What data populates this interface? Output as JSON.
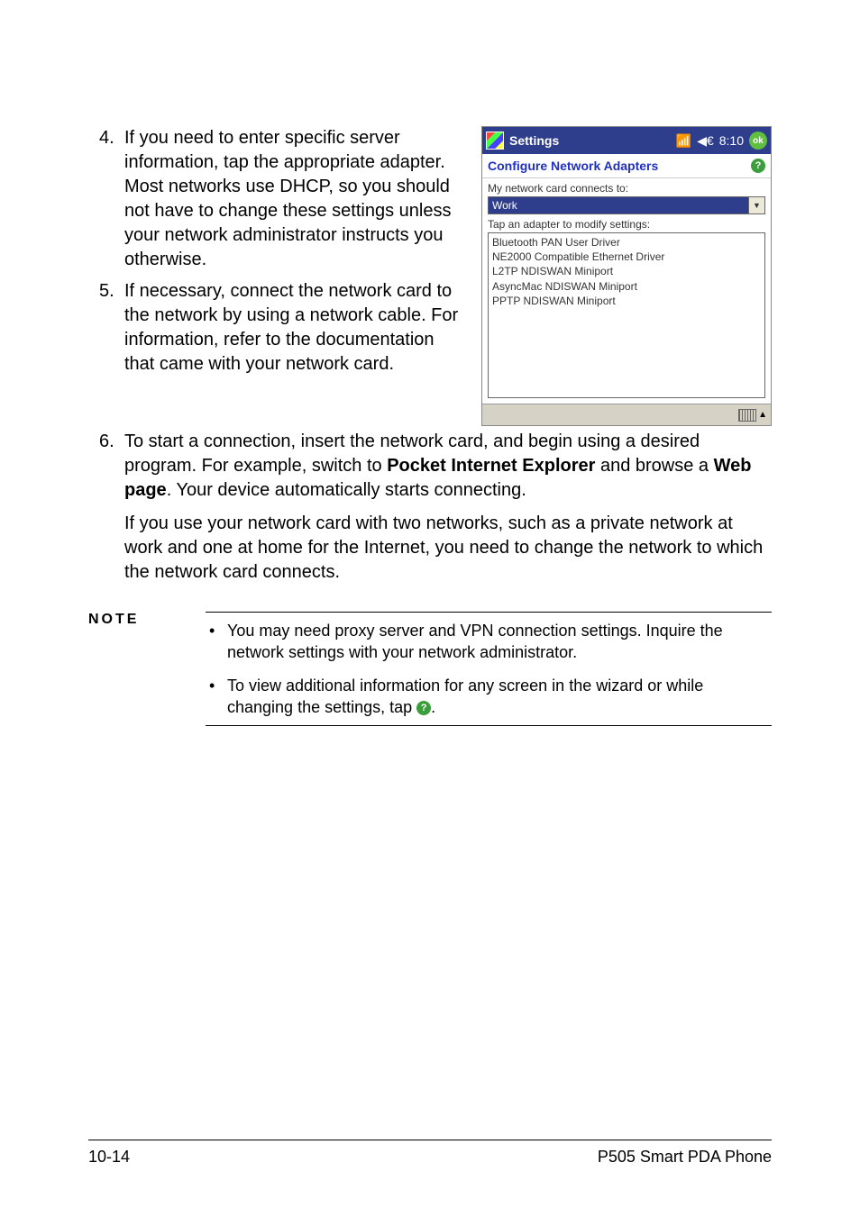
{
  "steps": {
    "s4": "If you need to enter specific server information, tap the appropriate adapter. Most networks use DHCP, so you should not have to change these settings unless your network administrator instructs you otherwise.",
    "s5": "If necessary, connect the network card to the network by using a network cable. For information, refer to the documentation that came with your network card.",
    "s6_pre": "To start a connection, insert the network card, and begin using a desired program. For example, switch to ",
    "s6_b1": "Pocket Internet Explorer",
    "s6_mid": " and browse a ",
    "s6_b2": "Web page",
    "s6_post": ". Your device automatically starts connecting.",
    "para2": "If you use your network card with two networks, such as a private network at work and one at home for the Internet, you need to change the network to which the network card connects."
  },
  "note": {
    "label": "NOTE",
    "i1": "You may need proxy server and VPN connection settings. Inquire the network settings with your network administrator.",
    "i2": "To view additional information for any screen in the wizard or while changing the settings, tap ",
    "dot": "."
  },
  "device": {
    "title": "Settings",
    "time": "8:10",
    "ok": "ok",
    "subheader": "Configure Network Adapters",
    "help": "?",
    "label1": "My network card connects to:",
    "dropdown": "Work",
    "label2": "Tap an adapter to modify settings:",
    "list": {
      "a": "Bluetooth PAN User Driver",
      "b": "NE2000 Compatible Ethernet Driver",
      "c": "L2TP NDISWAN Miniport",
      "d": "AsyncMac NDISWAN Miniport",
      "e": "PPTP NDISWAN Miniport"
    }
  },
  "footer": {
    "left": "10-14",
    "right": "P505 Smart PDA Phone"
  }
}
